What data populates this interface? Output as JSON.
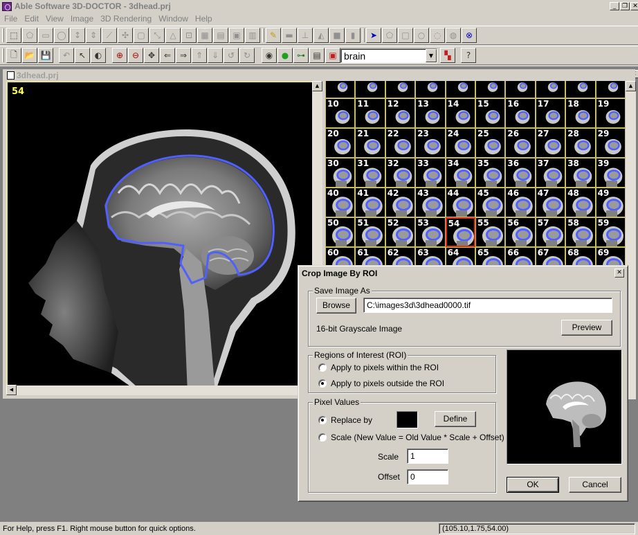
{
  "window": {
    "title": "Able Software 3D-DOCTOR - 3dhead.prj"
  },
  "menu": [
    "File",
    "Edit",
    "View",
    "Image",
    "3D Rendering",
    "Window",
    "Help"
  ],
  "toolbar1": {
    "icons": [
      "select-tool-icon",
      "polygon-tool-icon",
      "rectangle-tool-icon",
      "ellipse-tool-icon",
      "vertical-split-icon",
      "horizontal-split-icon",
      "line-tool-icon",
      "cross-tool-icon",
      "box-tool-icon",
      "resize-tool-icon",
      "triangle-tool-icon",
      "frame-tool-icon",
      "object-tool-icon",
      "obj-label-icon",
      "image-region-icon",
      "chart-tool-icon",
      "ruler-icon",
      "scanner-icon",
      "stamp-icon",
      "landscape-icon",
      "fill-box-icon",
      "bar-icon",
      "pointer-select-icon",
      "pentagon-icon",
      "square-icon",
      "circle-icon",
      "lasso-icon",
      "free-shape-icon",
      "delete-shape-icon"
    ]
  },
  "toolbar2": {
    "icons": [
      "new-file-icon",
      "open-folder-icon",
      "save-icon",
      "undo-icon",
      "arrow-pointer-icon",
      "contrast-icon",
      "zoom-in-icon",
      "zoom-out-icon",
      "pan-icon",
      "arrow-left-icon",
      "arrow-right-icon",
      "arrow-up-icon",
      "arrow-down-icon",
      "rotate-left-icon",
      "rotate-right-icon",
      "brain-render-icon",
      "green-seed-icon",
      "connector-icon",
      "page-icon",
      "red-object-icon",
      "object-color-icon",
      "help-context-icon"
    ],
    "object_combo": "brain"
  },
  "document": {
    "title": "3dhead.prj",
    "current_slice": "54"
  },
  "thumbnails": {
    "row0": [
      "",
      "",
      "",
      "",
      "",
      "",
      "",
      "",
      "",
      ""
    ],
    "numbers": [
      "10",
      "11",
      "12",
      "13",
      "14",
      "15",
      "16",
      "17",
      "18",
      "19",
      "20",
      "21",
      "22",
      "23",
      "24",
      "25",
      "26",
      "27",
      "28",
      "29",
      "30",
      "31",
      "32",
      "33",
      "34",
      "35",
      "36",
      "37",
      "38",
      "39",
      "40",
      "41",
      "42",
      "43",
      "44",
      "45",
      "46",
      "47",
      "48",
      "49",
      "50",
      "51",
      "52",
      "53",
      "54",
      "55",
      "56",
      "57",
      "58",
      "59",
      "60",
      "61",
      "62",
      "63",
      "64",
      "65",
      "66",
      "67",
      "68",
      "69"
    ],
    "selected": "54"
  },
  "dialog": {
    "title": "Crop Image By ROI",
    "save_group": "Save Image As",
    "browse_label": "Browse",
    "path_value": "C:\\images3d\\3dhead0000.tif",
    "format_text": "16-bit Grayscale Image",
    "preview_label": "Preview",
    "roi_group": "Regions of Interest (ROI)",
    "roi_within": "Apply to pixels within the ROI",
    "roi_outside": "Apply to pixels outside the ROI",
    "pixel_group": "Pixel Values",
    "replace_label": "Replace by",
    "define_label": "Define",
    "scale_option": "Scale (New Value = Old Value * Scale + Offset)",
    "scale_label": "Scale",
    "scale_value": "1",
    "offset_label": "Offset",
    "offset_value": "0",
    "ok_label": "OK",
    "cancel_label": "Cancel",
    "replace_color": "#000000"
  },
  "status": {
    "message": "For Help, press F1. Right mouse button for quick options.",
    "coords": "(105.10,1.75,54.00)"
  },
  "colors": {
    "roi_outline": "#5060ff",
    "slice_number": "#ffff60",
    "selection": "#e03010",
    "grid": "#c8c060"
  }
}
